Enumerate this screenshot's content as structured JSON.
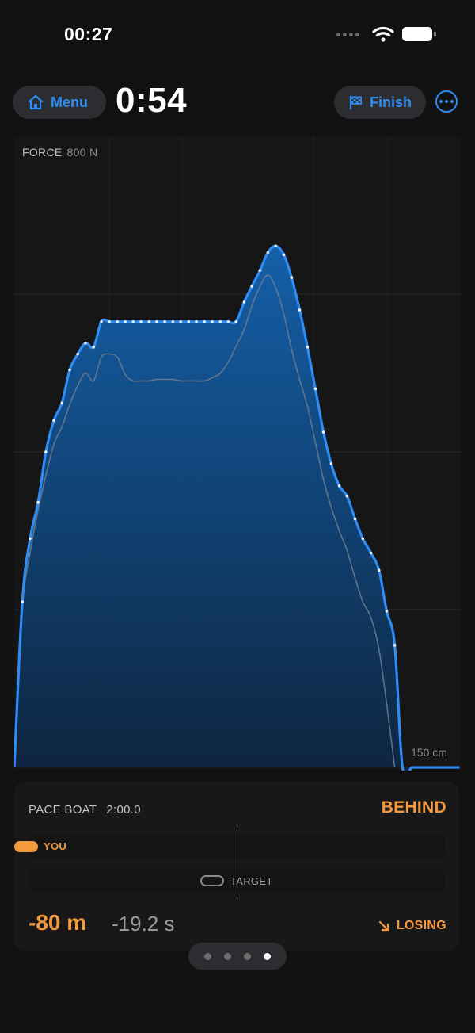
{
  "status_bar": {
    "time": "00:27"
  },
  "toolbar": {
    "menu_label": "Menu",
    "elapsed_time": "0:54",
    "finish_label": "Finish"
  },
  "chart": {
    "force_label": "FORCE",
    "force_value": "800 N",
    "length_label": "150 cm"
  },
  "colors": {
    "accent": "#2f8cf4",
    "warning": "#f39a3f",
    "background": "#111111"
  },
  "icons": [
    "home-icon",
    "finish-flag-icon",
    "more-icon",
    "wifi-icon",
    "battery-icon",
    "trend-down-icon"
  ],
  "chart_data": {
    "type": "area",
    "title": "",
    "xlabel": "",
    "ylabel": "FORCE",
    "y_max_label": "800 N",
    "x_max_label": "150 cm",
    "xlim": [
      0,
      150
    ],
    "ylim": [
      0,
      800
    ],
    "grid": true,
    "series": [
      {
        "x": [
          0,
          2.7,
          5.3,
          8.0,
          10.6,
          13.3,
          16.0,
          18.6,
          21.3,
          23.9,
          26.6,
          29.2,
          31.9,
          34.6,
          37.2,
          39.9,
          42.5,
          45.2,
          47.8,
          50.5,
          53.2,
          55.8,
          58.5,
          61.1,
          63.8,
          66.4,
          69.1,
          71.8,
          74.4,
          77.1,
          79.7,
          82.4,
          85.1,
          87.7,
          90.4,
          93.0,
          95.7,
          98.3,
          101.0,
          103.7,
          106.3,
          109.0,
          111.6,
          114.3,
          116.9,
          119.6,
          122.3,
          124.9,
          127.6,
          130.2,
          133.4,
          136.1,
          138.7,
          141.4,
          144.0,
          146.7,
          149.3
        ],
        "values": [
          0,
          210,
          290,
          336,
          400,
          440,
          462,
          504,
          524,
          538,
          533,
          565,
          565,
          565,
          565,
          565,
          565,
          565,
          565,
          565,
          565,
          565,
          565,
          565,
          565,
          565,
          565,
          565,
          565,
          590,
          610,
          630,
          653,
          661,
          650,
          621,
          580,
          533,
          480,
          425,
          385,
          357,
          344,
          315,
          290,
          272,
          250,
          198,
          155,
          0,
          0,
          0,
          0,
          0,
          0,
          0,
          0
        ]
      },
      {
        "x": [
          0,
          2.7,
          5.3,
          8.0,
          10.6,
          13.3,
          16.0,
          18.6,
          21.3,
          23.9,
          26.6,
          29.2,
          31.9,
          34.6,
          37.2,
          39.9,
          42.5,
          45.2,
          47.8,
          50.5,
          53.2,
          55.8,
          58.5,
          61.1,
          63.8,
          66.4,
          69.1,
          71.8,
          74.4,
          77.1,
          79.7,
          82.4,
          85.1,
          87.7,
          90.4,
          93.0,
          95.7,
          98.3,
          101.0,
          103.7,
          106.3,
          109.0,
          111.6,
          114.3,
          116.9,
          119.6,
          122.3,
          124.9,
          127.6
        ],
        "values": [
          0,
          200,
          272,
          326,
          370,
          410,
          432,
          460,
          484,
          500,
          490,
          520,
          524,
          520,
          498,
          490,
          490,
          490,
          492,
          492,
          492,
          490,
          490,
          490,
          490,
          494,
          500,
          514,
          534,
          555,
          585,
          610,
          624,
          608,
          575,
          530,
          492,
          458,
          412,
          365,
          330,
          300,
          275,
          240,
          210,
          190,
          150,
          80,
          0
        ]
      }
    ]
  },
  "pace": {
    "label": "PACE BOAT",
    "time": "2:00.0",
    "status": "BEHIND",
    "you_label": "YOU",
    "target_label": "TARGET",
    "gap_meters": "-80 m",
    "gap_seconds": "-19.2 s",
    "trend": "LOSING"
  },
  "pager": {
    "count": 4,
    "active": 4
  }
}
